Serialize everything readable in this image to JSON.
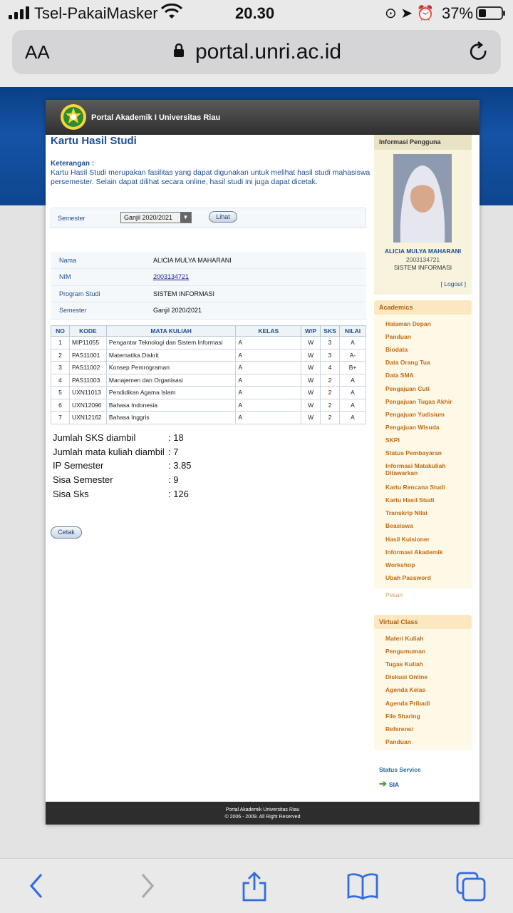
{
  "status_bar": {
    "carrier": "Tsel-PakaiMasker",
    "time": "20.30",
    "battery": "37%"
  },
  "browser": {
    "text_size_label": "AA",
    "url": "portal.unri.ac.id"
  },
  "header": {
    "title": "Portal Akademik I Universitas Riau"
  },
  "page": {
    "title": "Kartu Hasil Studi",
    "keterangan_label": "Keterangan :",
    "keterangan_text": "Kartu Hasil Studi merupakan fasilitas yang dapat digunakan untuk melihat hasil studi mahasiswa persemester. Selain dapat dilihat secara online, hasil studi ini juga dapat dicetak."
  },
  "semester_form": {
    "label": "Semester",
    "selected": "Ganjil 2020/2021",
    "button": "Lihat"
  },
  "student_info": [
    {
      "key": "Nama",
      "value": "ALICIA MULYA MAHARANI"
    },
    {
      "key": "NIM",
      "value": "2003134721"
    },
    {
      "key": "Program Studi",
      "value": "SISTEM INFORMASI"
    },
    {
      "key": "Semester",
      "value": "Ganjil 2020/2021"
    }
  ],
  "courses_table": {
    "headers": [
      "NO",
      "KODE",
      "MATA KULIAH",
      "KELAS",
      "W/P",
      "SKS",
      "NILAI"
    ],
    "rows": [
      [
        "1",
        "MIP11055",
        "Pengantar Teknologi dan Sistem Informasi",
        "A",
        "W",
        "3",
        "A"
      ],
      [
        "2",
        "PAS11001",
        "Matematika Diskrit",
        "A",
        "W",
        "3",
        "A-"
      ],
      [
        "3",
        "PAS11002",
        "Konsep Pemrograman",
        "A",
        "W",
        "4",
        "B+"
      ],
      [
        "4",
        "PAS11003",
        "Manajemen dan Organisasi",
        "A",
        "W",
        "2",
        "A"
      ],
      [
        "5",
        "UXN11013",
        "Pendidikan Agama Islam",
        "A",
        "W",
        "2",
        "A"
      ],
      [
        "6",
        "UXN12096",
        "Bahasa Indonesia",
        "A",
        "W",
        "2",
        "A"
      ],
      [
        "7",
        "UXN12162",
        "Bahasa Inggris",
        "A",
        "W",
        "2",
        "A"
      ]
    ]
  },
  "summary": [
    {
      "label": "Jumlah SKS diambil",
      "value": ": 18"
    },
    {
      "label": "Jumlah mata kuliah diambil",
      "value": ": 7"
    },
    {
      "label": "IP Semester",
      "value": ": 3.85"
    },
    {
      "label": "Sisa Semester",
      "value": ": 9"
    },
    {
      "label": "Sisa Sks",
      "value": ": 126"
    }
  ],
  "print_button": "Cetak",
  "user_panel": {
    "heading": "Informasi Pengguna",
    "name": "ALICIA MULYA MAHARANI",
    "nim": "2003134721",
    "prodi": "SISTEM INFORMASI",
    "logout": "[ Logout ]"
  },
  "academics_menu": {
    "heading": "Academics",
    "items": [
      "Halaman Depan",
      "Panduan",
      "Biodata",
      "Data Orang Tua",
      "Data SMA",
      "Pengajuan Cuti",
      "Pengajuan Tugas Akhir",
      "Pengajuan Yudisium",
      "Pengajuan Wisuda",
      "SKPI",
      "Status Pembayaran",
      "Informasi Matakuliah Ditawarkan",
      "Kartu Rencana Studi",
      "Kartu Hasil Studi",
      "Transkrip Nilai",
      "Beasiswa",
      "Hasil Kuisioner",
      "Informasi Akademik",
      "Workshop",
      "Ubah Password"
    ],
    "pesan": "Pesan"
  },
  "virtual_class_menu": {
    "heading": "Virtual Class",
    "items": [
      "Materi Kuliah",
      "Pengumuman",
      "Tugas Kuliah",
      "Diskusi Online",
      "Agenda Kelas",
      "Agenda Pribadi",
      "File Sharing",
      "Referensi",
      "Panduan"
    ]
  },
  "status_service": {
    "label": "Status Service",
    "link": "SIA"
  },
  "footer": {
    "line1": "Portal Akademik Universitas Riau",
    "line2": "© 2006 - 2009. All Right Reserved"
  },
  "colors": {
    "brand_blue": "#1d4f95",
    "menu_orange": "#c26a14",
    "header_dark": "#2f2f2f"
  }
}
